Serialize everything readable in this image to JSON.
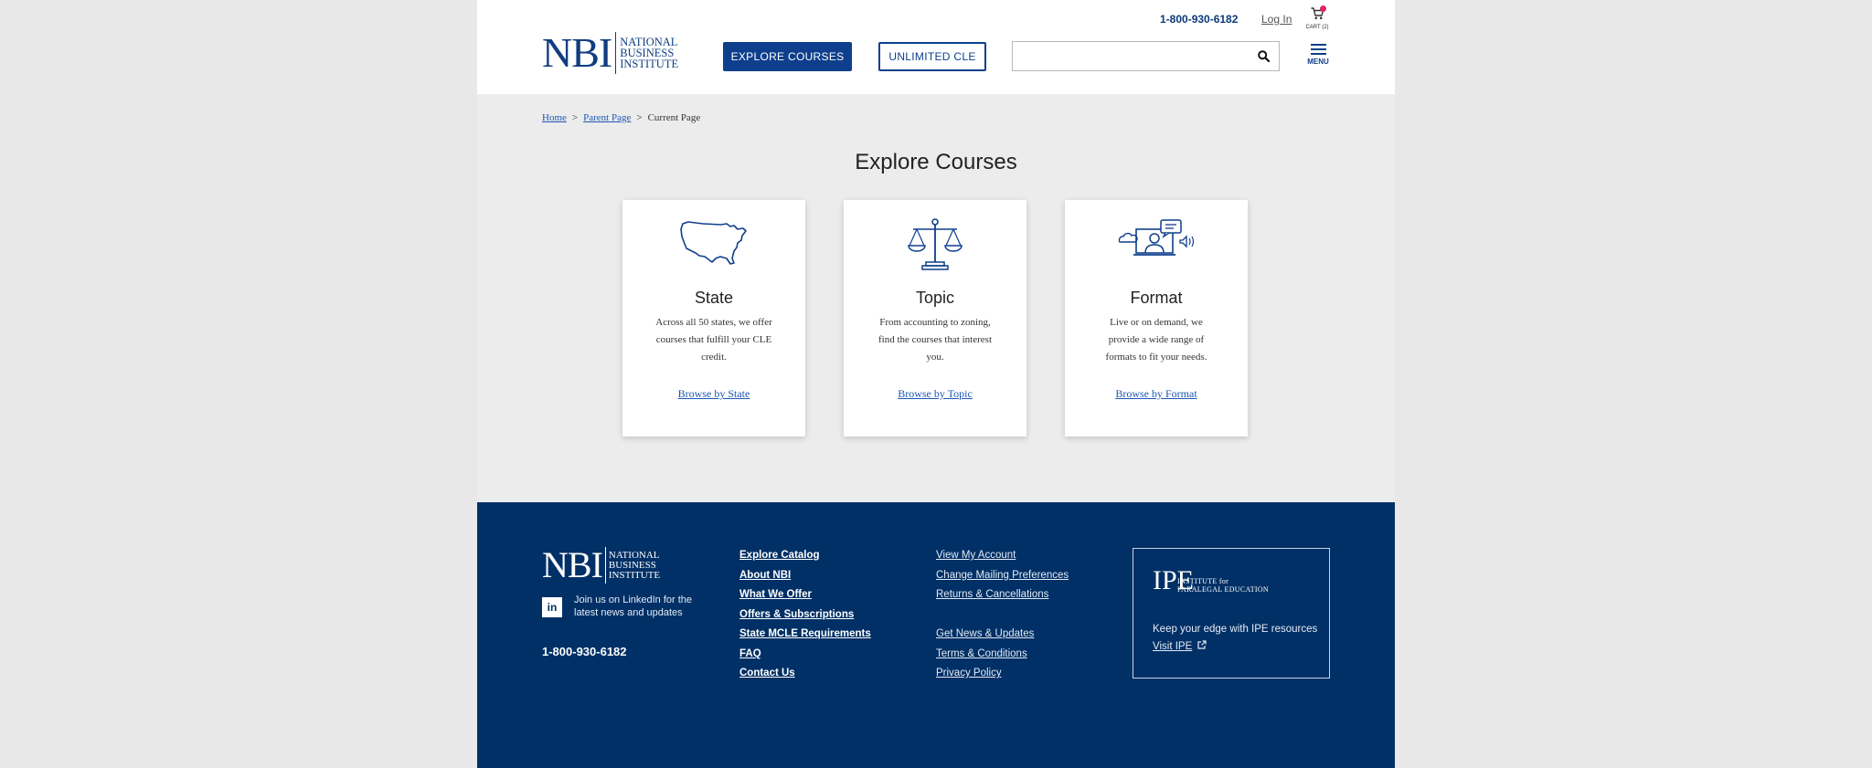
{
  "header": {
    "phone": "1-800-930-6182",
    "login_label": "Log In",
    "cart_label": "CART (2)",
    "logo_letters": "NBI",
    "logo_words": [
      "NATIONAL",
      "BUSINESS",
      "INSTITUTE"
    ],
    "explore_label": "EXPLORE COURSES",
    "unlimited_label": "UNLIMITED CLE",
    "search_value": "",
    "menu_label": "MENU"
  },
  "breadcrumb": {
    "home": "Home",
    "parent": "Parent Page",
    "current": "Current Page",
    "separator": ">"
  },
  "main": {
    "title": "Explore Courses",
    "cards": [
      {
        "icon": "usa-map-icon",
        "title": "State",
        "description": "Across all 50 states, we offer courses that fulfill your CLE credit.",
        "link": "Browse by State"
      },
      {
        "icon": "scales-of-justice-icon",
        "title": "Topic",
        "description": "From accounting to zoning, find the courses that interest you.",
        "link": "Browse by Topic"
      },
      {
        "icon": "online-learning-icon",
        "title": "Format",
        "description": "Live or on demand, we provide a wide range of formats to fit your needs.",
        "link": "Browse by Format"
      }
    ]
  },
  "footer": {
    "logo_letters": "NBI",
    "logo_words": [
      "NATIONAL",
      "BUSINESS",
      "INSTITUTE"
    ],
    "linkedin_letters": "in",
    "linkedin_text": "Join us on LinkedIn for the latest news and updates",
    "phone": "1-800-930-6182",
    "col1": [
      "Explore Catalog",
      "About NBI",
      "What We Offer",
      "Offers & Subscriptions",
      "State MCLE Requirements",
      "FAQ",
      "Contact Us"
    ],
    "col2a": [
      "View My Account",
      "Change Mailing Preferences",
      "Returns & Cancellations"
    ],
    "col2b": [
      "Get News & Updates",
      "Terms & Conditions",
      "Privacy Policy"
    ],
    "ipe": {
      "letters": "IPE",
      "words": [
        "INSTITUTE for",
        "PARALEGAL EDUCATION"
      ],
      "text": "Keep your edge with IPE resources",
      "link": "Visit IPE"
    }
  },
  "colors": {
    "brand_blue": "#0e3f8c",
    "footer_navy": "#003066",
    "link_blue": "#1d57b3",
    "cart_badge": "#e0245e"
  }
}
